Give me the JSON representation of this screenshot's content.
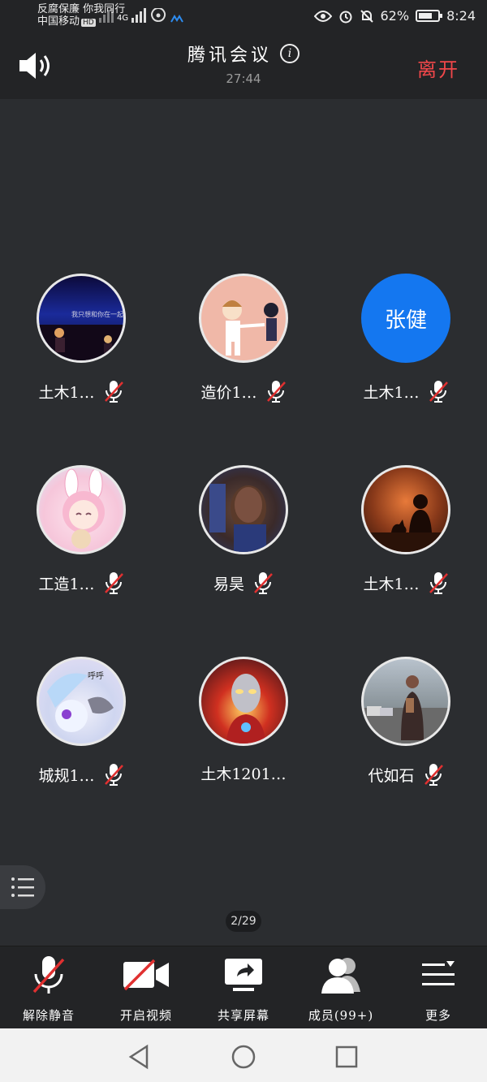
{
  "status_bar": {
    "carrier_line1": "反腐保廉 你我同行",
    "carrier_line2": "中国移动",
    "hd_badge": "HD",
    "network": "4G",
    "battery": "62%",
    "time": "8:24"
  },
  "header": {
    "title": "腾讯会议",
    "timer": "27:44",
    "leave_label": "离开"
  },
  "participants": [
    {
      "name": "土木1…",
      "muted": true
    },
    {
      "name": "造价1…",
      "muted": true
    },
    {
      "name": "土木1…",
      "muted": true,
      "avatar_text": "张健"
    },
    {
      "name": "工造1…",
      "muted": true
    },
    {
      "name": "易昊",
      "muted": true
    },
    {
      "name": "土木1…",
      "muted": true
    },
    {
      "name": "城规1…",
      "muted": true
    },
    {
      "name": "土木1201…",
      "muted": false
    },
    {
      "name": "代如石",
      "muted": true
    }
  ],
  "page_indicator": "2/29",
  "toolbar": {
    "unmute_label": "解除静音",
    "video_label": "开启视频",
    "share_label": "共享屏幕",
    "members_label": "成员(99+)",
    "more_label": "更多"
  },
  "colors": {
    "background": "#2b2d30",
    "leave": "#f0474a",
    "avatar_blue": "#1477f0",
    "mute_red": "#e03030"
  }
}
